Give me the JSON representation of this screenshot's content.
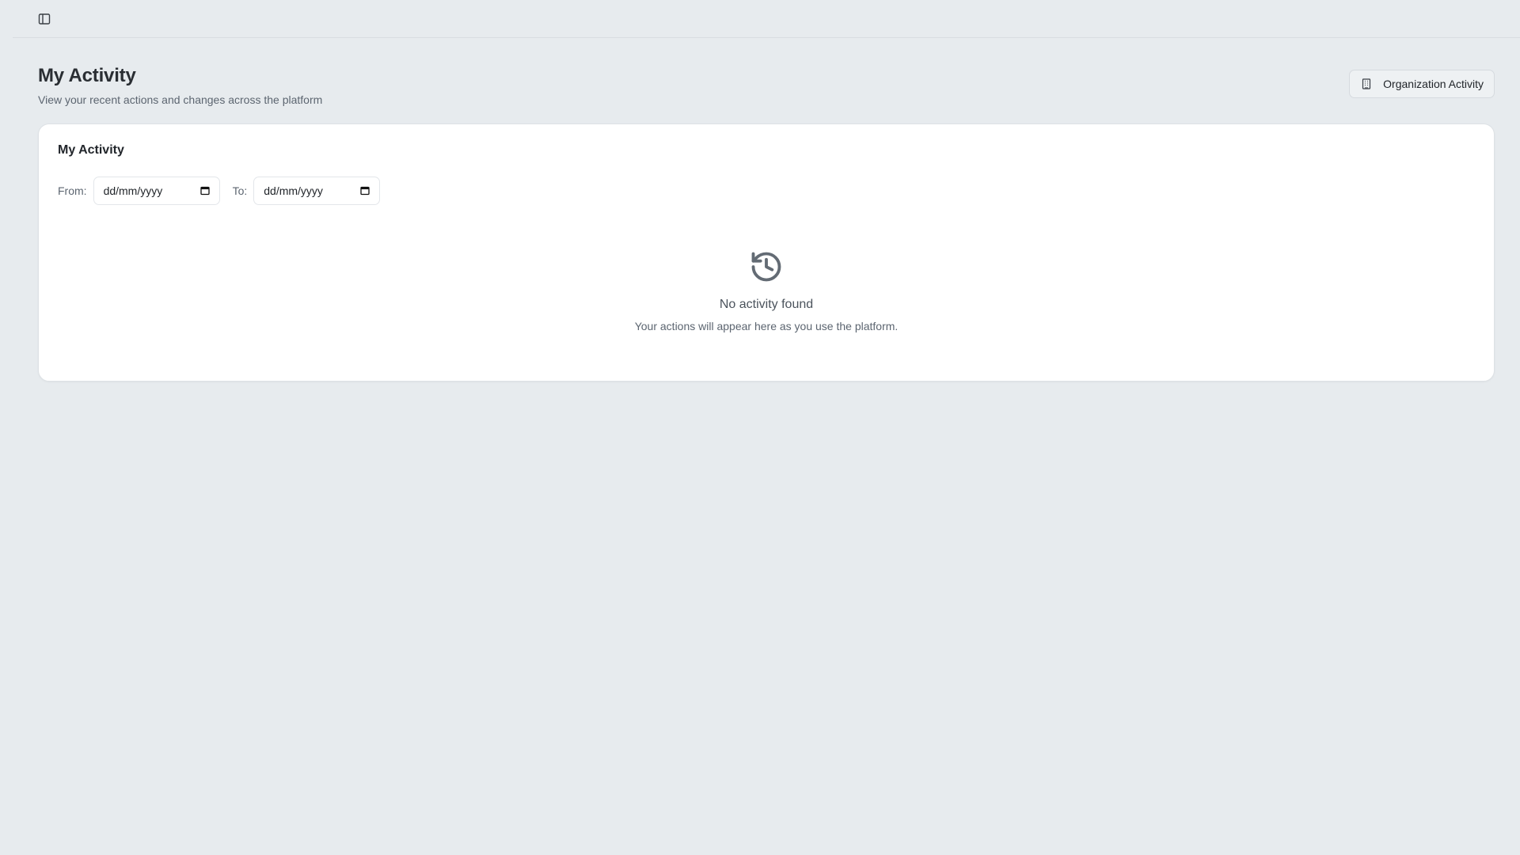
{
  "topbar": {
    "toggle_icon": "sidebar-panel-icon"
  },
  "header": {
    "title": "My Activity",
    "subtitle": "View your recent actions and changes across the platform",
    "org_button_label": "Organization Activity",
    "org_button_icon": "building-icon"
  },
  "card": {
    "title": "My Activity",
    "filters": {
      "from_label": "From:",
      "from_value": "dd/mm/yyyy",
      "to_label": "To:",
      "to_value": "dd/mm/yyyy",
      "calendar_icon": "calendar-icon"
    },
    "empty_state": {
      "icon": "history-icon",
      "title": "No activity found",
      "message": "Your actions will appear here as you use the platform."
    }
  },
  "colors": {
    "background": "#e7ebee",
    "card": "#ffffff",
    "text_muted": "#5c6570",
    "icon": "#636b74"
  }
}
